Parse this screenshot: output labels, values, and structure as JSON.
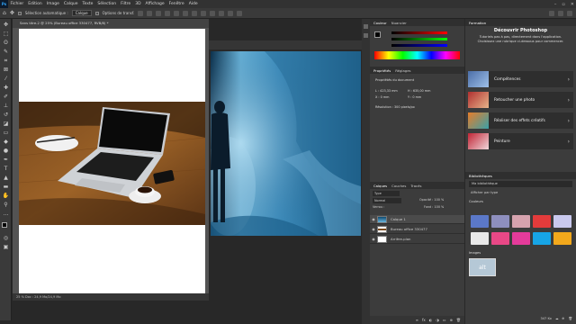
{
  "menubar": {
    "items": [
      "Fichier",
      "Edition",
      "Image",
      "Calque",
      "Texte",
      "Sélection",
      "Filtre",
      "3D",
      "Affichage",
      "Fenêtre",
      "Aide"
    ]
  },
  "options": {
    "auto_select_label": "Sélection automatique :",
    "auto_select_value": "Calque",
    "transform_label": "Options de transf."
  },
  "document": {
    "tab_title": "Sans titre-2 @ 25% (Bureau office 330477, RVB/8) *",
    "status": "25 %     Doc : 24,9 Mo/24,9 Mo"
  },
  "color_panel": {
    "tabs": [
      "Couleur",
      "Nuancier"
    ]
  },
  "properties_panel": {
    "tabs": [
      "Propriétés",
      "Réglages"
    ],
    "section": "Propriétés du document",
    "w_label": "L : 423,33 mm",
    "h_label": "H : 635,00 mm",
    "x_label": "X : 0 mm",
    "y_label": "Y : 0 mm",
    "resolution": "Résolution : 300 pixels/po"
  },
  "layers_panel": {
    "tabs": [
      "Calques",
      "Couches",
      "Tracés"
    ],
    "search_label": "Type",
    "blend_mode": "Normal",
    "opacity": "Opacité : 100 %",
    "lock_label": "Verrou :",
    "fill": "Fond : 100 %",
    "layers": [
      {
        "name": "Calque 1"
      },
      {
        "name": "Bureau office 330477"
      },
      {
        "name": "Arrière-plan"
      }
    ]
  },
  "learn_panel": {
    "tab": "Formation",
    "title": "Découvrir Photoshop",
    "description": "Tutoriels pas à pas, directement dans l'application. Choisissez une rubrique ci-dessous pour commencer.",
    "cards": [
      {
        "label": "Compétences"
      },
      {
        "label": "Retoucher une photo"
      },
      {
        "label": "Réaliser des effets créatifs"
      },
      {
        "label": "Peinture"
      }
    ]
  },
  "libraries_panel": {
    "tab": "Bibliothèques",
    "library_name": "Ma bibliothèque",
    "view_by": "Afficher par type",
    "colors_heading": "Couleurs",
    "images_heading": "Images",
    "image_thumb_label": "alt",
    "size_label": "347 Ko",
    "swatches": [
      "#5b78c8",
      "#8e8fbe",
      "#d6a3ae",
      "#e33b3b",
      "#c9c9ee",
      "#e9e9e9",
      "#e84886",
      "#e43b9a",
      "#17a5e6",
      "#f2a81c"
    ]
  },
  "colors": {
    "accent": "#31a8ff",
    "foreground": "#000000",
    "background": "#ffffff"
  }
}
